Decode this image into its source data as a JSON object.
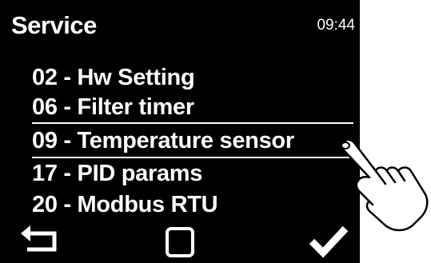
{
  "header": {
    "title": "Service",
    "time": "09:44"
  },
  "menu": {
    "items": [
      {
        "label": "02 - Hw Setting",
        "selected": false
      },
      {
        "label": "06 - Filter timer",
        "selected": false
      },
      {
        "label": "09 - Temperature sensor",
        "selected": true
      },
      {
        "label": "17 - PID params",
        "selected": false
      },
      {
        "label": "20 - Modbus RTU",
        "selected": false
      }
    ]
  },
  "footer": {
    "back_icon": "return-arrow-icon",
    "home_icon": "square-icon",
    "confirm_icon": "checkmark-icon"
  },
  "overlay": {
    "pointer_icon": "pointing-hand-icon"
  },
  "colors": {
    "screen_background": "#000000",
    "text": "#ffffff"
  }
}
